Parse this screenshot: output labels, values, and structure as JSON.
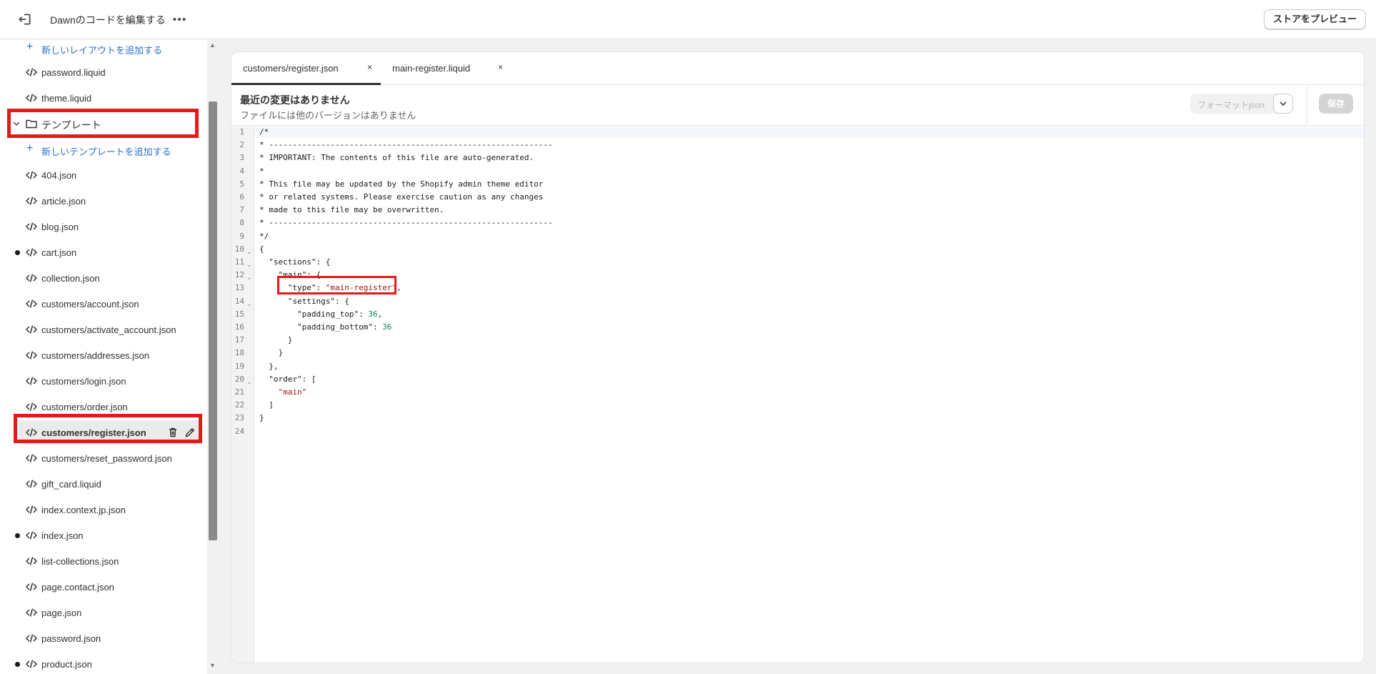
{
  "topbar": {
    "title": "Dawnのコードを編集する",
    "preview_label": "ストアをプレビュー",
    "exit_icon": "exit-icon",
    "more_icon": "more-icon"
  },
  "sidebar": {
    "add_layout": "新しいレイアウトを追加する",
    "files_top": [
      "password.liquid",
      "theme.liquid"
    ],
    "folder": "テンプレート",
    "add_template": "新しいテンプレートを追加する",
    "files": [
      {
        "name": "404.json",
        "modified": false
      },
      {
        "name": "article.json",
        "modified": false
      },
      {
        "name": "blog.json",
        "modified": false
      },
      {
        "name": "cart.json",
        "modified": true
      },
      {
        "name": "collection.json",
        "modified": false
      },
      {
        "name": "customers/account.json",
        "modified": false
      },
      {
        "name": "customers/activate_account.json",
        "modified": false
      },
      {
        "name": "customers/addresses.json",
        "modified": false
      },
      {
        "name": "customers/login.json",
        "modified": false
      },
      {
        "name": "customers/order.json",
        "modified": false
      },
      {
        "name": "customers/register.json",
        "modified": false,
        "selected": true
      },
      {
        "name": "customers/reset_password.json",
        "modified": false
      },
      {
        "name": "gift_card.liquid",
        "modified": false
      },
      {
        "name": "index.context.jp.json",
        "modified": false
      },
      {
        "name": "index.json",
        "modified": true
      },
      {
        "name": "list-collections.json",
        "modified": false
      },
      {
        "name": "page.contact.json",
        "modified": false
      },
      {
        "name": "page.json",
        "modified": false
      },
      {
        "name": "password.json",
        "modified": false
      },
      {
        "name": "product.json",
        "modified": true
      }
    ]
  },
  "tabs": [
    {
      "label": "customers/register.json",
      "close": "×",
      "active": true
    },
    {
      "label": "main-register.liquid",
      "close": "×",
      "active": false
    }
  ],
  "info": {
    "heading": "最近の変更はありません",
    "subtext": "ファイルには他のバージョンはありません",
    "format_label": "フォーマットjson",
    "save_label": "保存"
  },
  "code_lines": [
    "/*",
    "* ------------------------------------------------------------",
    "* IMPORTANT: The contents of this file are auto-generated.",
    "*",
    "* This file may be updated by the Shopify admin theme editor",
    "* or related systems. Please exercise caution as any changes",
    "* made to this file may be overwritten.",
    "* ------------------------------------------------------------",
    "*/",
    "{",
    "  \"sections\": {",
    "    \"main\": {",
    "      \"type\": \"main-register\",",
    "      \"settings\": {",
    "        \"padding_top\": 36,",
    "        \"padding_bottom\": 36",
    "      }",
    "    }",
    "  },",
    "  \"order\": [",
    "    \"main\"",
    "  ]",
    "}",
    ""
  ],
  "foldable_lines": [
    10,
    11,
    12,
    14,
    20
  ]
}
